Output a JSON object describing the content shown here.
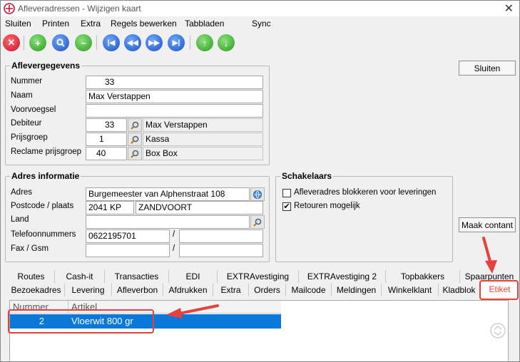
{
  "window": {
    "title": "Afleveradressen - Wijzigen kaart"
  },
  "menu": [
    "Sluiten",
    "Printen",
    "Extra",
    "Regels bewerken",
    "Tabbladen",
    "Sync"
  ],
  "toolbar": {
    "buttons": [
      "delete-record",
      "add-record",
      "search-record",
      "remove-record",
      "first-record",
      "prev-record",
      "next-record",
      "last-record",
      "move-up",
      "move-down"
    ]
  },
  "right_buttons": {
    "sluiten": "Sluiten",
    "maak_contant": "Maak contant"
  },
  "aflevergegevens": {
    "title": "Aflevergegevens",
    "nummer": {
      "label": "Nummer",
      "value": "33"
    },
    "naam": {
      "label": "Naam",
      "value": "Max Verstappen"
    },
    "voorvoegsel": {
      "label": "Voorvoegsel",
      "value": ""
    },
    "debiteur": {
      "label": "Debiteur",
      "value": "33",
      "name": "Max Verstappen"
    },
    "prijsgroep": {
      "label": "Prijsgroep",
      "value": "1",
      "name": "Kassa"
    },
    "reclame": {
      "label": "Reclame prijsgroep",
      "value": "40",
      "name": "Box Box"
    }
  },
  "adres": {
    "title": "Adres informatie",
    "adres": {
      "label": "Adres",
      "value": "Burgemeester van Alphenstraat 108"
    },
    "postcode": {
      "label": "Postcode / plaats",
      "value": "2041 KP",
      "plaats": "ZANDVOORT"
    },
    "land": {
      "label": "Land",
      "value": ""
    },
    "telefoon": {
      "label": "Telefoonnummers",
      "value": "0622195701",
      "sep": "/",
      "value2": ""
    },
    "fax": {
      "label": "Fax / Gsm",
      "value": "",
      "sep": "/",
      "value2": ""
    }
  },
  "schakelaars": {
    "title": "Schakelaars",
    "items": [
      {
        "label": "Afleveradres blokkeren voor leveringen",
        "checked": false,
        "mark": ""
      },
      {
        "label": "Retouren mogelijk",
        "checked": true,
        "mark": "✔"
      }
    ]
  },
  "tabs_row1": [
    "Routes",
    "Cash-it",
    "Transacties",
    "EDI",
    "EXTRAvestiging",
    "EXTRAvestiging 2",
    "Topbakkers",
    "Spaarpunten"
  ],
  "tabs_row2": [
    "Bezoekadres",
    "Levering",
    "Afleverbon",
    "Afdrukken",
    "Extra",
    "Orders",
    "Mailcode",
    "Meldingen",
    "Winkelklant",
    "Kladblok",
    "Etiket"
  ],
  "grid": {
    "columns": [
      "Nummer",
      "Artikel"
    ],
    "rows": [
      {
        "nummer": "2",
        "artikel": "Vloerwit 800 gr"
      }
    ]
  },
  "colors": {
    "accent": "#0a78d7",
    "annotation": "#e8413b",
    "active_tab_text": "#e8413b"
  }
}
